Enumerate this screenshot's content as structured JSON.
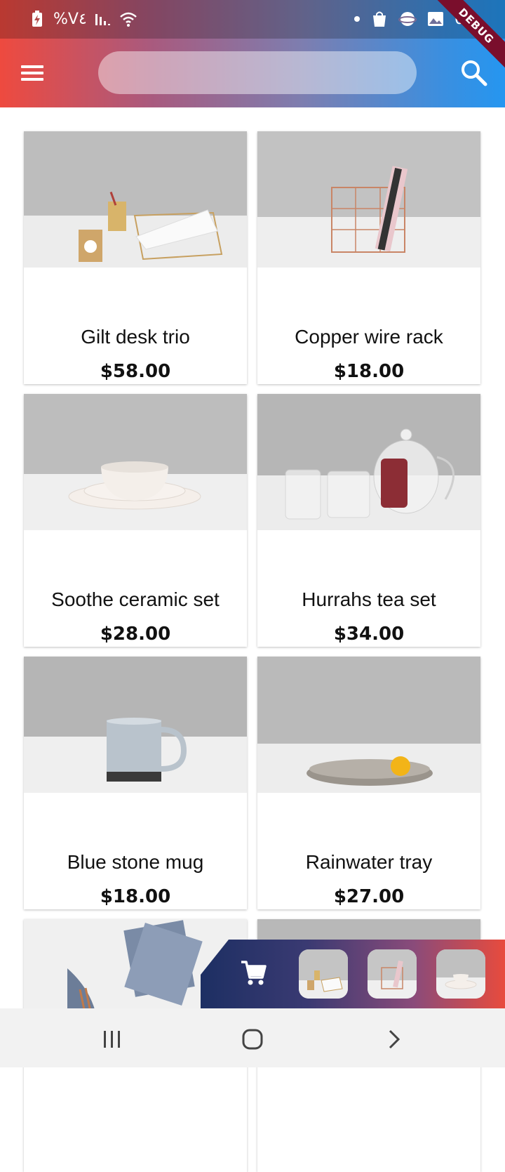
{
  "status_bar": {
    "left_text": "%V٤",
    "right_text": "0",
    "icons": [
      "battery-charging-icon",
      "signal-icon",
      "wifi-icon",
      "dot-icon",
      "shopping-bag-icon",
      "planet-icon",
      "image-icon"
    ]
  },
  "debug_banner": "DEBUG",
  "app_bar": {
    "menu_icon": "hamburger-menu-icon",
    "search_value": "",
    "search_icon": "search-icon"
  },
  "products": [
    {
      "name": "Gilt desk trio",
      "price": "$58.00"
    },
    {
      "name": "Copper wire rack",
      "price": "$18.00"
    },
    {
      "name": "Soothe ceramic set",
      "price": "$28.00"
    },
    {
      "name": "Hurrahs tea set",
      "price": "$34.00"
    },
    {
      "name": "Blue stone mug",
      "price": "$18.00"
    },
    {
      "name": "Rainwater tray",
      "price": "$27.00"
    },
    {
      "name": "",
      "price": ""
    },
    {
      "name": "",
      "price": ""
    }
  ],
  "cart": {
    "icon": "shopping-cart-icon",
    "thumbnails": [
      "Gilt desk trio",
      "Copper wire rack",
      "Soothe ceramic set"
    ]
  },
  "nav_bar": {
    "icons": [
      "recent-apps-icon",
      "home-icon",
      "back-icon"
    ]
  },
  "colors": {
    "gradient_start": "#ee4a3f",
    "gradient_end": "#2596f0",
    "cart_start": "#1d2f63",
    "cart_end": "#e84b3d"
  }
}
